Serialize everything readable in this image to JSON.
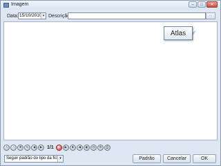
{
  "window": {
    "title": "Imagem",
    "controls": {
      "minimize": "–",
      "maximize": "□",
      "close": "✕"
    }
  },
  "toolbar": {
    "date_label": "Data:",
    "date_value": "15/10/2010",
    "date_dropdown": "▾",
    "description_label": "Descrição:",
    "description_value": "",
    "description_button": "···"
  },
  "tooltip": {
    "text": "Atlas"
  },
  "navigation": {
    "buttons_left": [
      {
        "name": "zoom-in-icon",
        "glyph": "+"
      },
      {
        "name": "zoom-out-icon",
        "glyph": "−"
      },
      {
        "name": "pan-icon",
        "glyph": "✥"
      },
      {
        "name": "rotate-icon",
        "glyph": "↻"
      },
      {
        "name": "first-icon",
        "glyph": "◀"
      },
      {
        "name": "next-icon",
        "glyph": "▶"
      }
    ],
    "page_indicator": "1/1",
    "buttons_right": [
      {
        "name": "record-icon",
        "glyph": "●",
        "variant": "rec"
      },
      {
        "name": "play-icon",
        "glyph": "▶"
      },
      {
        "name": "stop-icon",
        "glyph": "■"
      },
      {
        "name": "rewind-icon",
        "glyph": "◀"
      },
      {
        "name": "camera-icon",
        "glyph": "◉"
      },
      {
        "name": "fit-icon",
        "glyph": "⊡"
      },
      {
        "name": "settings-icon",
        "glyph": "⚙"
      },
      {
        "name": "print-icon",
        "glyph": "⎙"
      }
    ]
  },
  "footer": {
    "select_value": "Seguir padrão do tipo da ficha",
    "select_dropdown": "▾",
    "default_button": "Padrão",
    "cancel_button": "Cancelar",
    "ok_button": "OK"
  }
}
